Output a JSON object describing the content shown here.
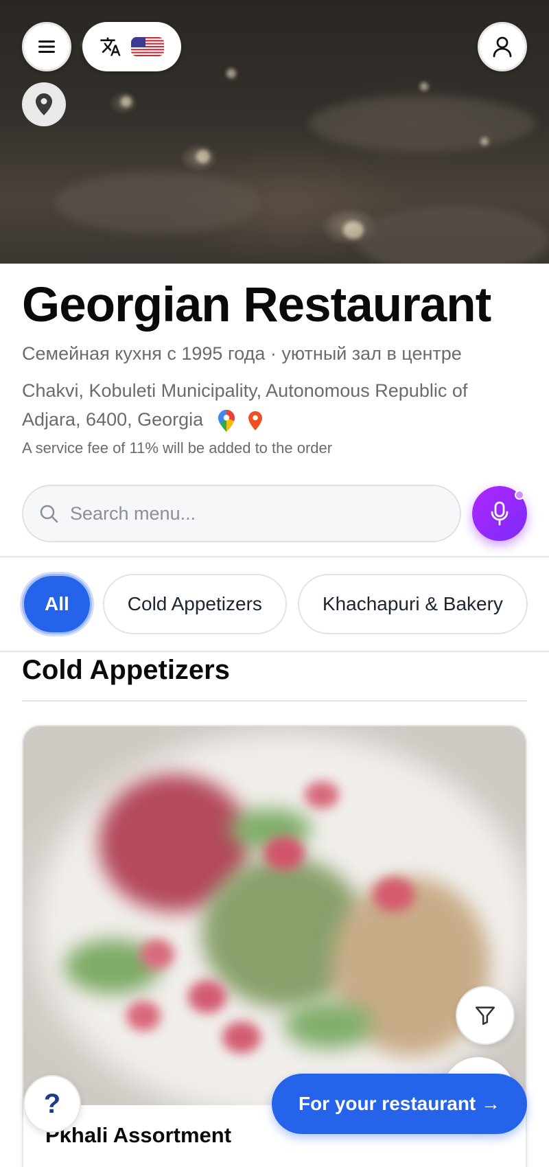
{
  "restaurant": {
    "name": "Georgian Restaurant",
    "subtitle": "Семейная кухня с 1995 года · уютный зал в центре",
    "address": "Chakvi, Kobuleti Municipality, Autonomous Republic of Adjara, 6400, Georgia",
    "service_fee_note": "A service fee of 11% will be added to the order"
  },
  "header": {
    "menu_icon": "hamburger-menu-icon",
    "translate_icon": "translate-icon",
    "flag_icon": "us-flag-icon",
    "profile_icon": "user-profile-icon",
    "location_icon": "map-pin-icon"
  },
  "search": {
    "placeholder": "Search menu..."
  },
  "categories": [
    {
      "label": "All",
      "active": true
    },
    {
      "label": "Cold Appetizers",
      "active": false
    },
    {
      "label": "Khachapuri & Bakery",
      "active": false
    }
  ],
  "section": {
    "title": "Cold Appetizers"
  },
  "items": [
    {
      "name": "Pkhali Assortment"
    }
  ],
  "floating": {
    "cta_label": "For your restaurant →",
    "help_label": "?"
  },
  "colors": {
    "accent": "#2563eb",
    "mic_gradient_start": "#b026ff",
    "mic_gradient_end": "#7b2cf7",
    "muted_text": "#6b6b6b"
  }
}
